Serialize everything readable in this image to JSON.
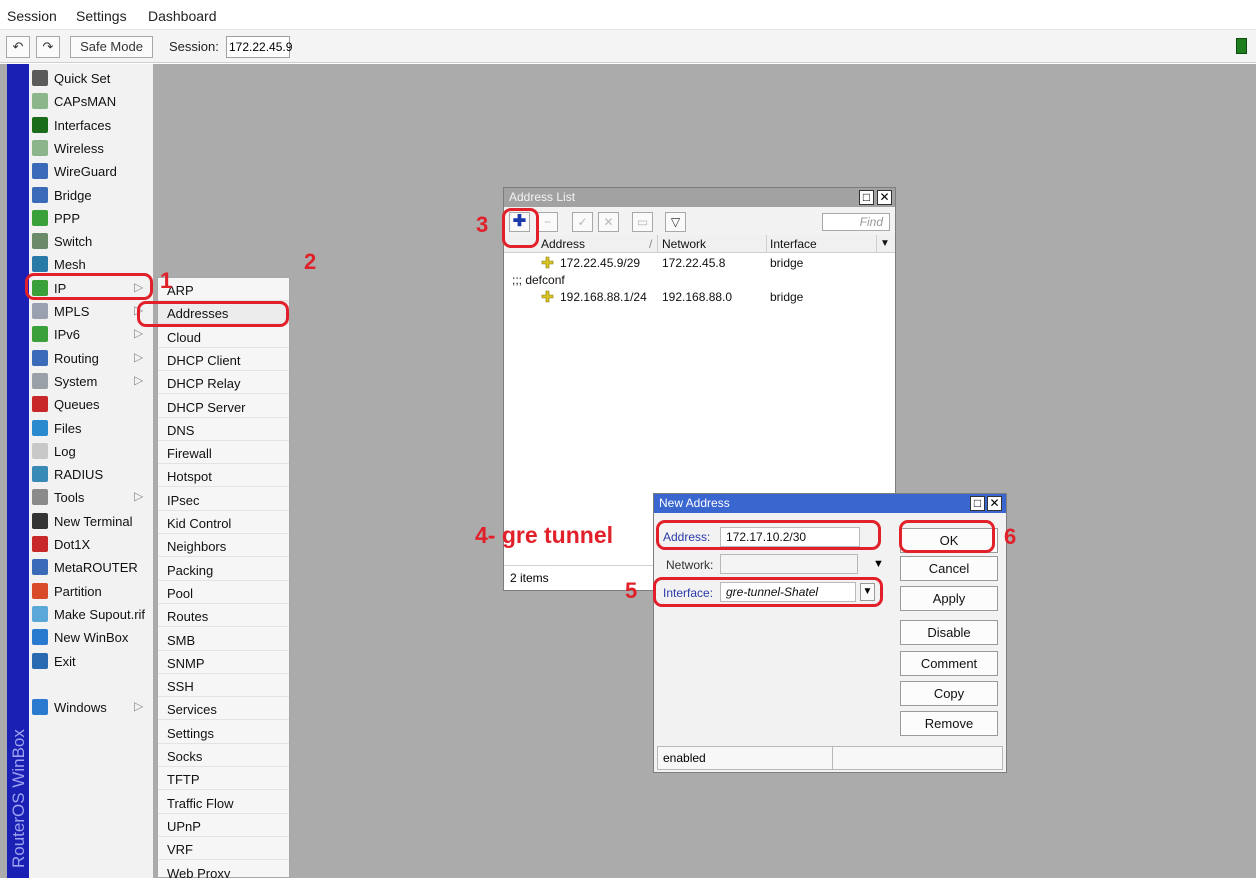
{
  "menubar": {
    "items": [
      "Session",
      "Settings",
      "Dashboard"
    ]
  },
  "toolbar": {
    "undo_icon": "undo-icon",
    "redo_icon": "redo-icon",
    "safe_mode_label": "Safe Mode",
    "session_label": "Session:",
    "session_value": "172.22.45.9",
    "status_color": "#1e7e1e"
  },
  "brand": {
    "text": "RouterOS WinBox"
  },
  "left_menu": {
    "items": [
      {
        "label": "Quick Set",
        "icon": "wand-icon",
        "color": "#5a5a5a"
      },
      {
        "label": "CAPsMAN",
        "icon": "antenna-icon",
        "color": "#8bb58b"
      },
      {
        "label": "Interfaces",
        "icon": "interfaces-icon",
        "color": "#1a6b1a"
      },
      {
        "label": "Wireless",
        "icon": "antenna-icon",
        "color": "#8bb58b"
      },
      {
        "label": "WireGuard",
        "icon": "wireguard-icon",
        "color": "#3a6ab8"
      },
      {
        "label": "Bridge",
        "icon": "bridge-icon",
        "color": "#3a6ab8"
      },
      {
        "label": "PPP",
        "icon": "ppp-icon",
        "color": "#3aa03a"
      },
      {
        "label": "Switch",
        "icon": "switch-icon",
        "color": "#6a8a6a"
      },
      {
        "label": "Mesh",
        "icon": "mesh-icon",
        "color": "#2a7aa8"
      },
      {
        "label": "IP",
        "icon": "ip-icon",
        "color": "#3aa03a",
        "arrow": "▷"
      },
      {
        "label": "MPLS",
        "icon": "mpls-icon",
        "color": "#9aa0b0",
        "arrow": "▷"
      },
      {
        "label": "IPv6",
        "icon": "ipv6-icon",
        "color": "#3aa03a",
        "arrow": "▷"
      },
      {
        "label": "Routing",
        "icon": "routing-icon",
        "color": "#3a6ab8",
        "arrow": "▷"
      },
      {
        "label": "System",
        "icon": "gear-icon",
        "color": "#9aa0a8",
        "arrow": "▷"
      },
      {
        "label": "Queues",
        "icon": "queues-icon",
        "color": "#c8282a"
      },
      {
        "label": "Files",
        "icon": "folder-icon",
        "color": "#2a8ad0"
      },
      {
        "label": "Log",
        "icon": "log-icon",
        "color": "#c8c8c8"
      },
      {
        "label": "RADIUS",
        "icon": "radius-icon",
        "color": "#3a8ab8"
      },
      {
        "label": "Tools",
        "icon": "tools-icon",
        "color": "#8a8a8a",
        "arrow": "▷"
      },
      {
        "label": "New Terminal",
        "icon": "terminal-icon",
        "color": "#333333"
      },
      {
        "label": "Dot1X",
        "icon": "dot1x-icon",
        "color": "#c8282a"
      },
      {
        "label": "MetaROUTER",
        "icon": "metarouter-icon",
        "color": "#3a6ab8"
      },
      {
        "label": "Partition",
        "icon": "partition-icon",
        "color": "#d84a2a"
      },
      {
        "label": "Make Supout.rif",
        "icon": "supout-icon",
        "color": "#5aa8d8"
      },
      {
        "label": "New WinBox",
        "icon": "winbox-icon",
        "color": "#2a7ad0"
      },
      {
        "label": "Exit",
        "icon": "exit-icon",
        "color": "#2a6ab0"
      },
      {
        "label": "Windows",
        "icon": "windows-icon",
        "color": "#2a7ad0",
        "arrow": "▷"
      }
    ]
  },
  "submenu": {
    "items": [
      "ARP",
      "Addresses",
      "Cloud",
      "DHCP Client",
      "DHCP Relay",
      "DHCP Server",
      "DNS",
      "Firewall",
      "Hotspot",
      "IPsec",
      "Kid Control",
      "Neighbors",
      "Packing",
      "Pool",
      "Routes",
      "SMB",
      "SNMP",
      "SSH",
      "Services",
      "Settings",
      "Socks",
      "TFTP",
      "Traffic Flow",
      "UPnP",
      "VRF",
      "Web Proxy"
    ]
  },
  "address_list": {
    "title": "Address List",
    "find_placeholder": "Find",
    "columns": [
      "Address",
      "/",
      "Network",
      "Interface"
    ],
    "rows": [
      {
        "address": "172.22.45.9/29",
        "network": "172.22.45.8",
        "interface": "bridge"
      },
      {
        "comment": ";;; defconf"
      },
      {
        "address": "192.168.88.1/24",
        "network": "192.168.88.0",
        "interface": "bridge"
      }
    ],
    "status": "2 items"
  },
  "new_address": {
    "title": "New Address",
    "address_label": "Address:",
    "address_value": "172.17.10.2/30",
    "network_label": "Network:",
    "network_value": "",
    "interface_label": "Interface:",
    "interface_value": "gre-tunnel-Shatel",
    "buttons": [
      "OK",
      "Cancel",
      "Apply",
      "Disable",
      "Comment",
      "Copy",
      "Remove"
    ],
    "status": "enabled"
  },
  "annotations": {
    "n1": "1",
    "n2": "2",
    "n3": "3",
    "n4": "4- gre tunnel",
    "n5": "5",
    "n6": "6",
    "color": "#e1202a"
  }
}
